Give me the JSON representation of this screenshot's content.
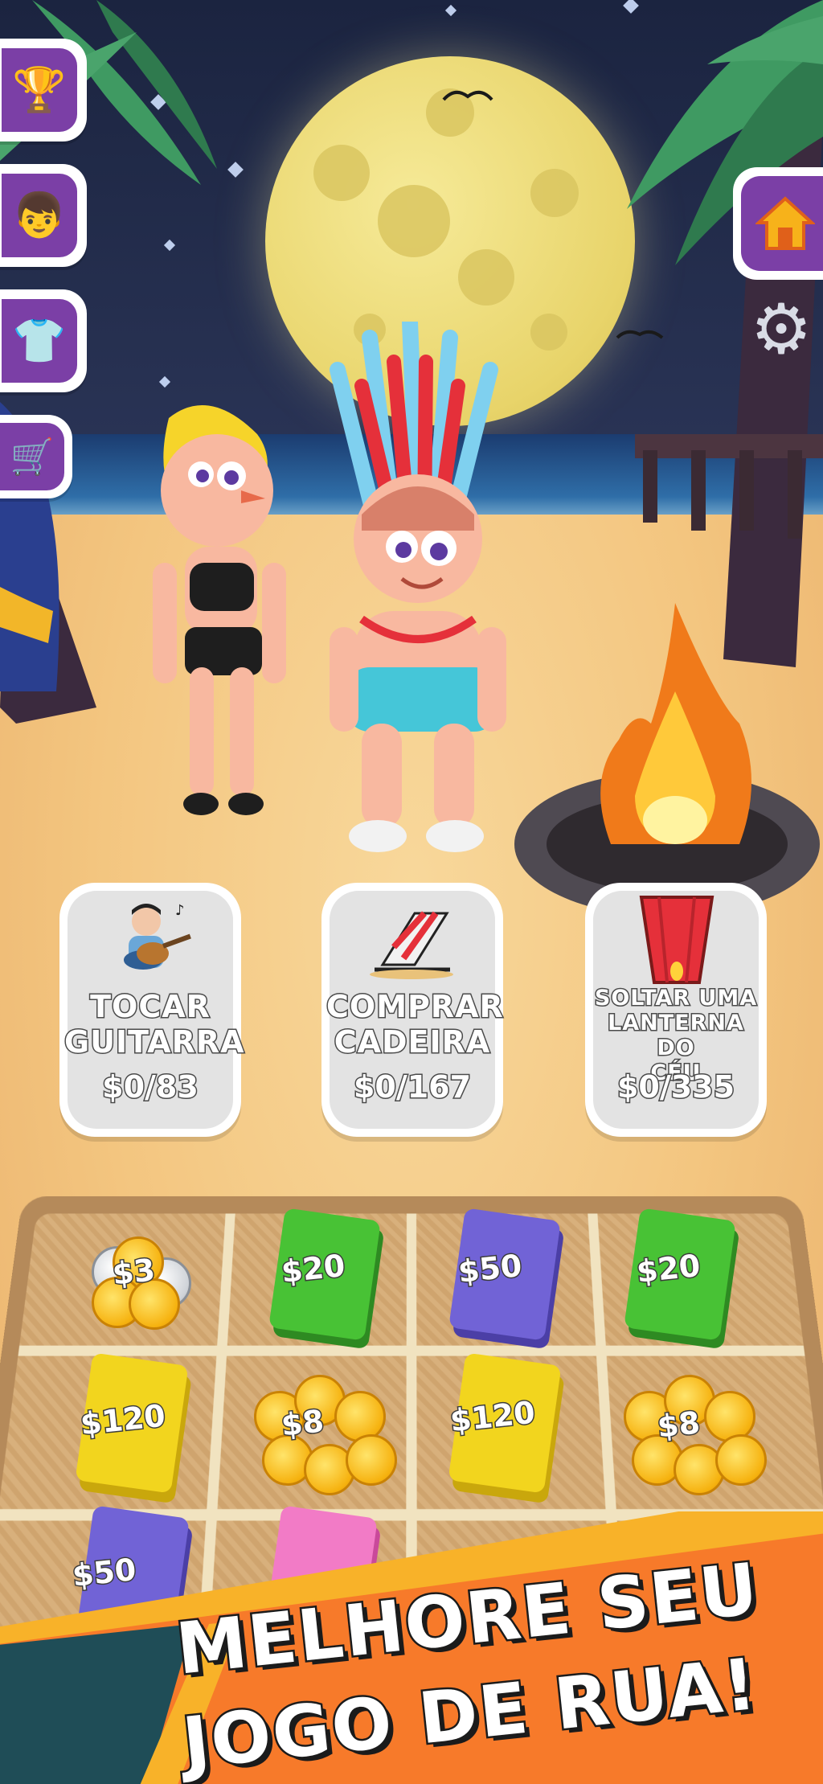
{
  "app": {
    "name": "street-music-game-promo"
  },
  "side_menu": [
    {
      "id": "trophy",
      "icon": "trophy-icon",
      "glyph": "🏆"
    },
    {
      "id": "upgrade",
      "icon": "character-upgrade-icon",
      "glyph": "👦"
    },
    {
      "id": "outfit",
      "icon": "tshirt-icon",
      "glyph": "👕"
    },
    {
      "id": "shop",
      "icon": "cart-icon",
      "glyph": "🛒"
    }
  ],
  "top_right": {
    "home_icon": "home-icon",
    "home_glyph": "⌂",
    "settings_icon": "gear-icon",
    "settings_glyph": "⚙"
  },
  "actions": [
    {
      "id": "play-guitar",
      "title_line1": "TOCAR",
      "title_line2": "GUITARRA",
      "price": "$0/83",
      "icon": "guitar-player-icon"
    },
    {
      "id": "buy-chair",
      "title_line1": "COMPRAR",
      "title_line2": "CADEIRA",
      "price": "$0/167",
      "icon": "beach-chair-icon"
    },
    {
      "id": "release-lantern",
      "title_line1": "SOLTAR UMA",
      "title_line2": "LANTERNA DO",
      "title_line3": "CÉU",
      "price": "$0/335",
      "icon": "sky-lantern-icon"
    }
  ],
  "tray": {
    "items": [
      {
        "label": "$3",
        "kind": "coins",
        "color": "#f6c21a"
      },
      {
        "label": "$20",
        "kind": "bill",
        "color": "#48c235"
      },
      {
        "label": "$50",
        "kind": "bill",
        "color": "#7163d6"
      },
      {
        "label": "$20",
        "kind": "bill",
        "color": "#48c235"
      },
      {
        "label": "$120",
        "kind": "bill",
        "color": "#f2d51e"
      },
      {
        "label": "$8",
        "kind": "coins",
        "color": "#f6c21a"
      },
      {
        "label": "$120",
        "kind": "bill",
        "color": "#f2d51e"
      },
      {
        "label": "$8",
        "kind": "coins",
        "color": "#f6c21a"
      },
      {
        "label": "$50",
        "kind": "bill",
        "color": "#7163d6"
      },
      {
        "label": "",
        "kind": "bill",
        "color": "#f27bc6"
      }
    ]
  },
  "banner": {
    "line1": "MELHORE SEU",
    "line2": "JOGO DE RUA!"
  },
  "colors": {
    "menu_purple": "#7b3fa6",
    "banner_orange": "#f77a2a",
    "banner_yellow": "#f8b229",
    "banner_dark": "#1f4d57"
  }
}
